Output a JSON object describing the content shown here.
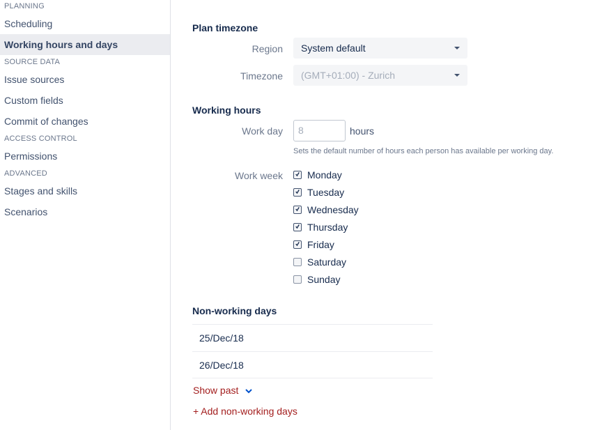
{
  "sidebar": {
    "sections": [
      {
        "heading": "PLANNING",
        "items": [
          {
            "label": "Scheduling"
          },
          {
            "label": "Working hours and days"
          }
        ]
      },
      {
        "heading": "SOURCE DATA",
        "items": [
          {
            "label": "Issue sources"
          },
          {
            "label": "Custom fields"
          },
          {
            "label": "Commit of changes"
          }
        ]
      },
      {
        "heading": "ACCESS CONTROL",
        "items": [
          {
            "label": "Permissions"
          }
        ]
      },
      {
        "heading": "ADVANCED",
        "items": [
          {
            "label": "Stages and skills"
          },
          {
            "label": "Scenarios"
          }
        ]
      }
    ],
    "active": "Working hours and days"
  },
  "timezone": {
    "title": "Plan timezone",
    "region_label": "Region",
    "region_value": "System default",
    "timezone_label": "Timezone",
    "timezone_value": "(GMT+01:00) - Zurich"
  },
  "hours": {
    "title": "Working hours",
    "workday_label": "Work day",
    "workday_value": "8",
    "unit": "hours",
    "helper": "Sets the default number of hours each person has available per working day.",
    "workweek_label": "Work week",
    "days": [
      {
        "label": "Monday",
        "checked": true
      },
      {
        "label": "Tuesday",
        "checked": true
      },
      {
        "label": "Wednesday",
        "checked": true
      },
      {
        "label": "Thursday",
        "checked": true
      },
      {
        "label": "Friday",
        "checked": true
      },
      {
        "label": "Saturday",
        "checked": false
      },
      {
        "label": "Sunday",
        "checked": false
      }
    ]
  },
  "nonworking": {
    "title": "Non-working days",
    "dates": [
      "25/Dec/18",
      "26/Dec/18"
    ],
    "show_past": "Show past",
    "add_label": "+ Add non-working days"
  },
  "colors": {
    "link": "#a31e1e",
    "chevron": "#0052cc",
    "active_bg": "#ebecf0"
  }
}
